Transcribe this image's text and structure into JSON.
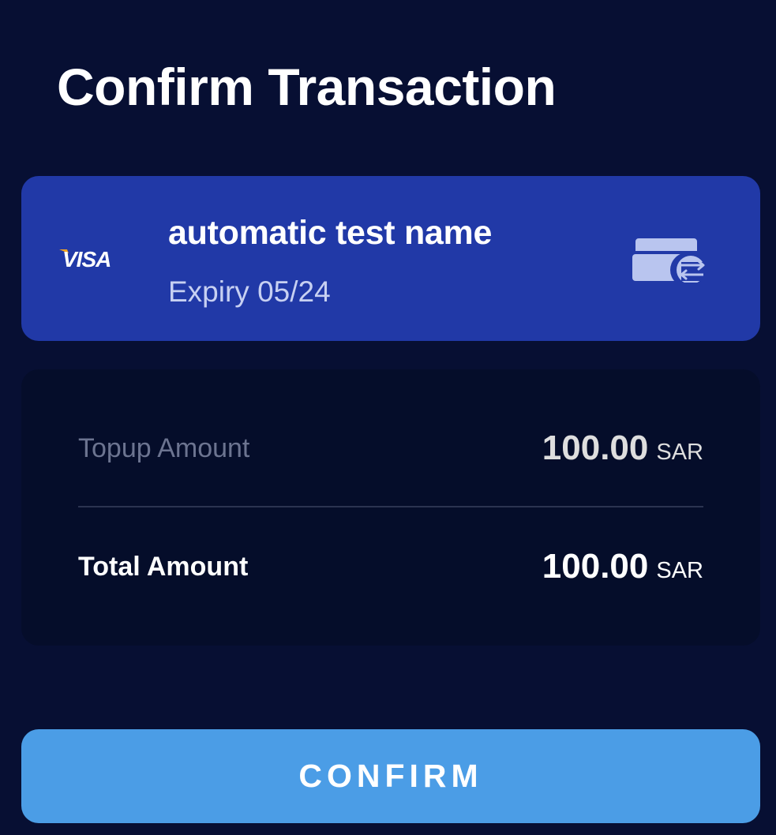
{
  "page": {
    "title": "Confirm Transaction",
    "background_color": "#070f33"
  },
  "card": {
    "brand": "VISA",
    "brand_icon": "visa-logo",
    "holder_name": "automatic test name",
    "expiry": "Expiry 05/24",
    "swap_icon": "card-swap-icon",
    "panel_color": "#2139a7"
  },
  "summary": {
    "topup_label": "Topup Amount",
    "topup_value": "100.00",
    "topup_currency": "SAR",
    "total_label": "Total Amount",
    "total_value": "100.00",
    "total_currency": "SAR"
  },
  "actions": {
    "confirm_label": "CONFIRM",
    "confirm_color": "#4b9de6"
  }
}
